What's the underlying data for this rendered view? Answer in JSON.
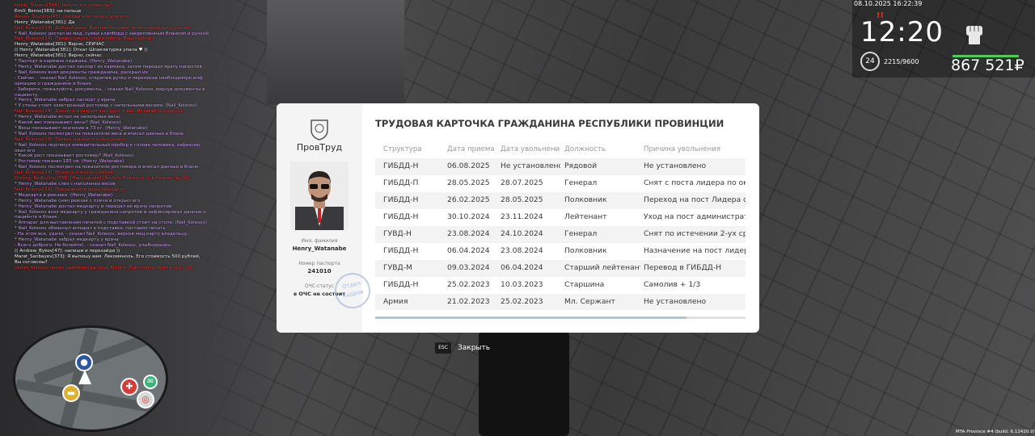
{
  "hud": {
    "datetime": "08.10.2025 16:22:39",
    "time": "12:20",
    "alert": "!!",
    "level": "24",
    "xp": "2215/9600",
    "money": "867 521₽",
    "fist_icon": "fist-icon"
  },
  "footer": {
    "build": "MTA Province #4 (build: 6.12420.9)"
  },
  "chat": [
    {
      "text": "Hardy_Silvano[384]: Чем то могу помочь?",
      "color": "red"
    },
    {
      "text": "Emili_Benso[383]: на пальце",
      "color": "white"
    },
    {
      "text": "Alexey_Soshkov[43]: пройдите в палату для этого",
      "color": "red"
    },
    {
      "text": "Henry_Watanabe[381]: Да",
      "color": "white"
    },
    {
      "text": "Nail_Kolesov[24]: Добрый день. Вам необходимо пройть медкарту, верно?",
      "color": "red"
    },
    {
      "text": "* Nail_Kolesov достал из мед. сумки клипборд с закрепленным бланком и ручкой",
      "color": "pink"
    },
    {
      "text": "Nail_Kolesov[24]: Предоставьте, пожалуйста, Ваш паспорт.",
      "color": "red"
    },
    {
      "text": "Henry_Watanabe[381]: Верно, СЕЙЧАС",
      "color": "white"
    },
    {
      "text": "(( Henry_Watanabe[381]: Откат Шпаклатурка упала ♥ ))",
      "color": "white"
    },
    {
      "text": "Henry_Watanabe[381]: Верно, сейчас",
      "color": "white"
    },
    {
      "text": "* Паспорт в кармане пиджака. (Henry_Watanabe)",
      "color": "pink"
    },
    {
      "text": "* Henry_Watanabe достал паспорт из кармана, затем передал врачу напротив",
      "color": "pink"
    },
    {
      "text": "* Nail_Kolesov взял документы гражданина, раскрыл их",
      "color": "pink"
    },
    {
      "text": "- Сейчас, - сказал Nail_Kolesov, открепив ручку и переписав необходимую инф",
      "color": "pink"
    },
    {
      "text": "ормацию о гражданине в бланк.",
      "color": "pink"
    },
    {
      "text": "- Заберите, пожалуйста, документы, - сказал Nail_Kolesov, вернув документы в",
      "color": "pink"
    },
    {
      "text": "пациенту.",
      "color": "pink"
    },
    {
      "text": "* Henry_Watanabe забрал паспорт у врача",
      "color": "pink"
    },
    {
      "text": "* У стены стоит электронный ростомер с напольными весами. (Nail_Kolesov)",
      "color": "pink"
    },
    {
      "text": "Nail_Kolesov[24]: Давайте измерим ваш рост и вес. Вставайте на весы.",
      "color": "red"
    },
    {
      "text": "* Henry_Watanabe встал на напольные весы",
      "color": "pink"
    },
    {
      "text": "* Какой вес показывают весы? (Nail_Kolesov)",
      "color": "pink"
    },
    {
      "text": "* Весы показывают значение в 73 кг. (Henry_Watanabe)",
      "color": "pink"
    },
    {
      "text": "* Nail_Kolesov посмотрел на показатели веса и вписал данные в бланк",
      "color": "pink"
    },
    {
      "text": "Nail_Kolesov[24]: Теперь держите спину ровно.",
      "color": "red"
    },
    {
      "text": "* Nail_Kolesov подтянул измерительный прибор к голове человека, зафиксир",
      "color": "pink"
    },
    {
      "text": "овал его",
      "color": "pink"
    },
    {
      "text": "* Какой рост показывает ростомер? (Nail_Kolesov)",
      "color": "pink"
    },
    {
      "text": "* Ростомер показал 183 см. (Henry_Watanabe)",
      "color": "pink"
    },
    {
      "text": "* Nail_Kolesov посмотрел на показатели ростомера и вписал данные в бланк",
      "color": "pink"
    },
    {
      "text": "Nail_Kolesov[24]: Можете слезать с весов.",
      "color": "red"
    },
    {
      "text": "Dmitriy_Redbullov [PM]: [Нарушение] (Ambrin_Dubrovskiy) в бланке (by VI)",
      "color": "red"
    },
    {
      "text": "* Henry_Watanabe слез с напольных весов",
      "color": "pink"
    },
    {
      "text": "Nail_Kolesov[24]: Передавайте вашу медкарту.",
      "color": "red"
    },
    {
      "text": "* Медкарта в рюкзаке. (Henry_Watanabe)",
      "color": "pink"
    },
    {
      "text": "* Henry_Watanabe снял рюкзак с плеча и открыл его",
      "color": "pink"
    },
    {
      "text": "* Henry_Watanabe достал медкарту и передал ее врачу напротив",
      "color": "pink"
    },
    {
      "text": "* Nail_Kolesov взял медкарту у гражданина напротив и зафиксировал данные о",
      "color": "pink"
    },
    {
      "text": "пациенте в бланк.",
      "color": "pink"
    },
    {
      "text": "* Аппарат для выставления печатей с подставкой стоит на столе. (Nail_Kolesov)",
      "color": "pink"
    },
    {
      "text": "* Nail_Kolesov обмакнул аппарат в подставке, поставил печать",
      "color": "pink"
    },
    {
      "text": "- На этом все, удачи, - сказал Nail_Kolesov, вернув мед.карту владельцу.",
      "color": "pink"
    },
    {
      "text": "* Henry_Watanabe забрал медкарту у врача",
      "color": "pink"
    },
    {
      "text": "- Всего доброго. Не болейте!, - сказал Nail_Kolesov, улыбнувшись.",
      "color": "pink"
    },
    {
      "text": "(( Andrew_Bykov[47]: напиши и перезайди ))",
      "color": "white"
    },
    {
      "text": "Marat_Sanbayev[373]: Я выпишу вам. Лекоменоль. Его стоимость 500 рублей,",
      "color": "white"
    },
    {
      "text": "Вы согласны?",
      "color": "white"
    },
    {
      "text": "Vadim_Kolesov начал [администратора] Ambrin_Dubrovskiy (причина by VI)",
      "color": "red"
    }
  ],
  "card": {
    "title": "ТРУДОВАЯ КАРТОЧКА ГРАЖДАНИНА РЕСПУБЛИКИ ПРОВИНЦИИ",
    "org": "ПровТруд",
    "name_label": "Имя, фамилия",
    "name": "Henry_Watanabe",
    "passport_label": "Номер паспорта",
    "passport": "241010",
    "ochs_label": "ОЧС-статус",
    "ochs": "в ОЧС не состоит",
    "stamp_text": "Отдел кадров",
    "columns": [
      "Структура",
      "Дата приема",
      "Дата увольнения",
      "Должность",
      "Причина увольнения"
    ],
    "rows": [
      [
        "ГИБДД-Н",
        "06.08.2025",
        "Не установлено",
        "Рядовой",
        "Не установлено"
      ],
      [
        "ГИБДД-П",
        "28.05.2025",
        "28.07.2025",
        "Генерал",
        "Снят с поста лидера по оконч"
      ],
      [
        "ГИБДД-Н",
        "26.02.2025",
        "28.05.2025",
        "Полковник",
        "Переход на пост Лидера фр"
      ],
      [
        "ГИБДД-Н",
        "30.10.2024",
        "23.11.2024",
        "Лейтенант",
        "Уход на пост администратора"
      ],
      [
        "ГУВД-Н",
        "23.08.2024",
        "24.10.2024",
        "Генерал",
        "Снят по истечении 2-ух сроков"
      ],
      [
        "ГИБДД-Н",
        "06.04.2024",
        "23.08.2024",
        "Полковник",
        "Назначение на пост лидера Г"
      ],
      [
        "ГУВД-М",
        "09.03.2024",
        "06.04.2024",
        "Старший лейтенант",
        "Перевод в ГИБДД-Н"
      ],
      [
        "ГИБДД-Н",
        "25.02.2023",
        "10.03.2023",
        "Старшина",
        "Самолив + 1/3"
      ],
      [
        "Армия",
        "21.02.2023",
        "25.02.2023",
        "Мл. Сержант",
        "Не установлено"
      ]
    ],
    "scroll_fraction": 0.84
  },
  "esc": {
    "key": "ESC",
    "label": "Закрыть"
  }
}
